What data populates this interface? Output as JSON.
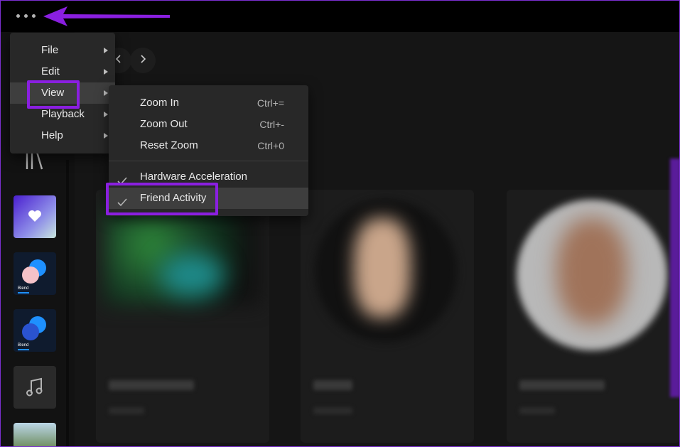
{
  "topbar": {
    "more_icon": "more-horizontal-icon"
  },
  "nav": {
    "back_icon": "chevron-left-icon",
    "forward_icon": "chevron-right-icon"
  },
  "sidebar": {
    "library_icon": "library-icon",
    "items": [
      {
        "name": "liked-songs",
        "icon": "heart-icon"
      },
      {
        "name": "blend-1",
        "caption": "Blend"
      },
      {
        "name": "blend-2",
        "caption": "Blend"
      },
      {
        "name": "local-files",
        "icon": "music-note-icon"
      },
      {
        "name": "playlist-photo"
      }
    ]
  },
  "main_menu": {
    "items": [
      {
        "label": "File",
        "has_submenu": true
      },
      {
        "label": "Edit",
        "has_submenu": true
      },
      {
        "label": "View",
        "has_submenu": true,
        "active": true
      },
      {
        "label": "Playback",
        "has_submenu": true
      },
      {
        "label": "Help",
        "has_submenu": true
      }
    ]
  },
  "view_menu": {
    "items": [
      {
        "label": "Zoom In",
        "shortcut": "Ctrl+="
      },
      {
        "label": "Zoom Out",
        "shortcut": "Ctrl+-"
      },
      {
        "label": "Reset Zoom",
        "shortcut": "Ctrl+0"
      },
      {
        "label": "Hardware Acceleration",
        "checked": true
      },
      {
        "label": "Friend Activity",
        "checked": true,
        "active": true
      }
    ]
  },
  "colors": {
    "annotation": "#8a1fe0",
    "menu_bg": "#282828",
    "menu_hover": "#3e3e3e",
    "topbar": "#000000"
  }
}
